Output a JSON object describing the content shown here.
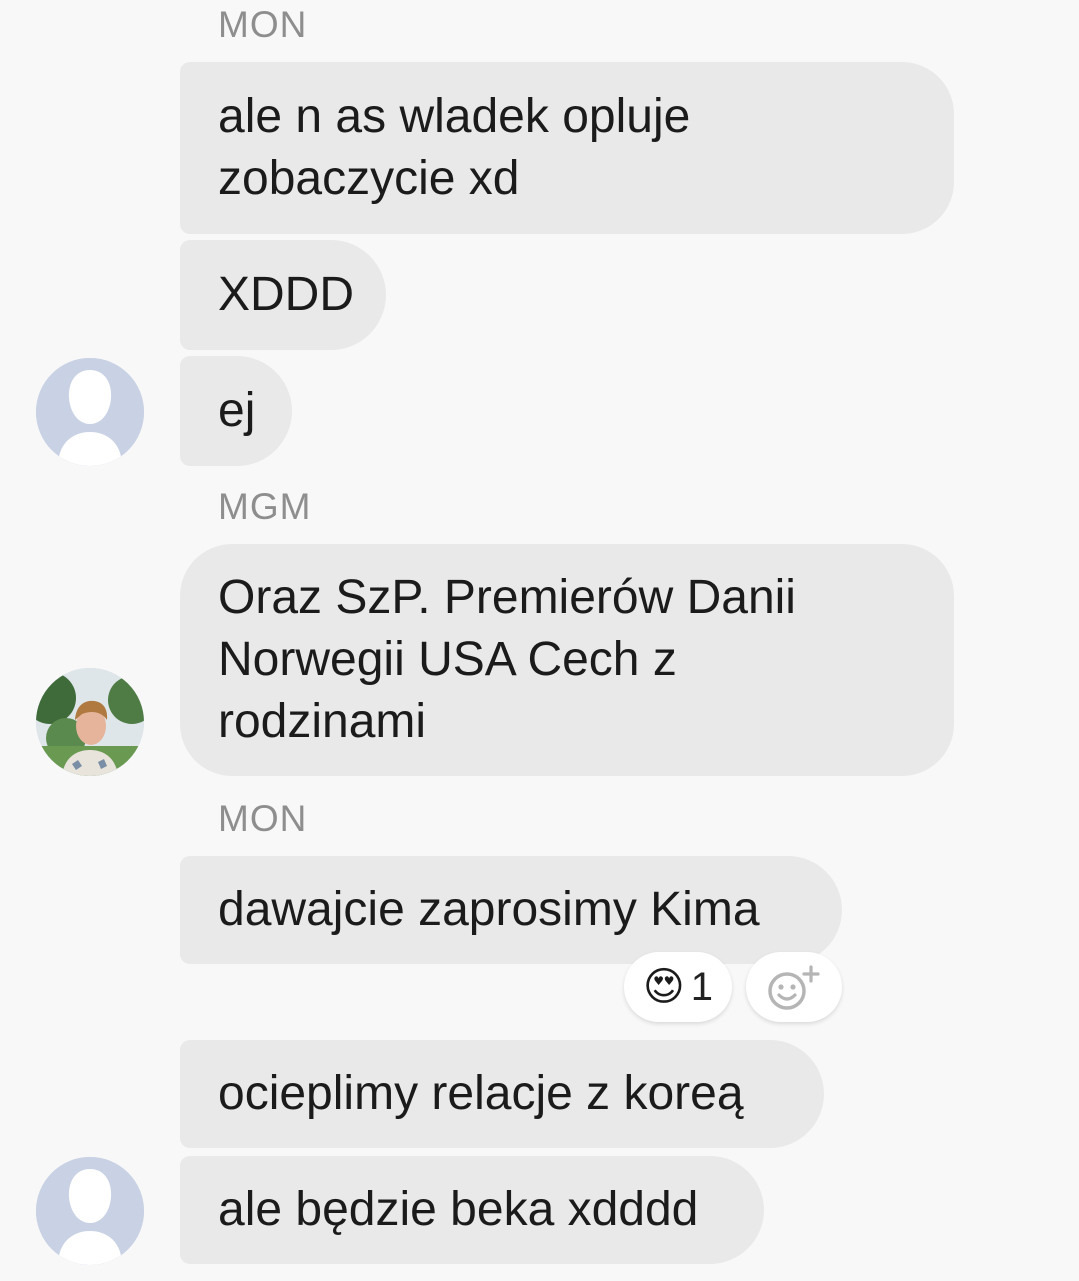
{
  "conversation": {
    "groups": [
      {
        "sender": "MON",
        "messages": [
          "ale n as wladek opluje\nzobaczycie xd",
          "XDDD",
          "ej"
        ]
      },
      {
        "sender": "MGM",
        "messages": [
          "Oraz SzP. Premierów Danii\nNorwegii USA Cech z\nrodzinami"
        ]
      },
      {
        "sender": "MON",
        "messages": [
          "dawajcie zaprosimy Kima",
          "ocieplimy relacje z koreą",
          "ale będzie beka xdddd"
        ],
        "reaction": {
          "emoji": "😍",
          "emoji_icon": "heart-eyes-emoji-icon",
          "count": "1",
          "add_icon": "add-reaction-icon"
        }
      }
    ]
  },
  "colors": {
    "background": "#f8f8f8",
    "bubble": "#e9e9e9",
    "sender_label": "#8e8e8e",
    "default_avatar": "#c9d2e4"
  }
}
